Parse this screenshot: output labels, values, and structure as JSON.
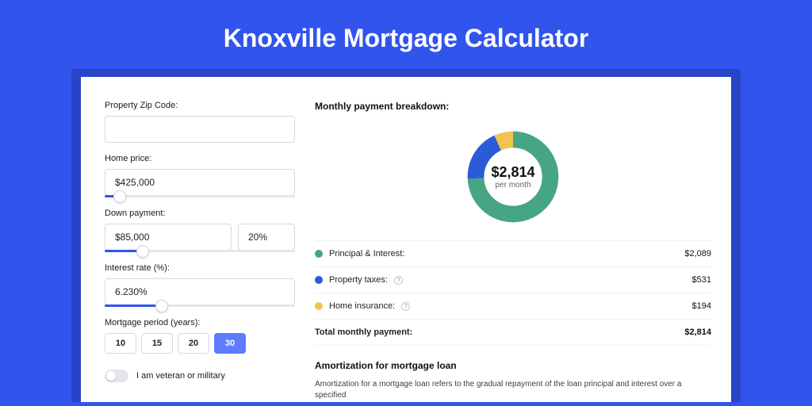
{
  "title": "Knoxville Mortgage Calculator",
  "form": {
    "zip": {
      "label": "Property Zip Code:",
      "value": ""
    },
    "homePrice": {
      "label": "Home price:",
      "value": "$425,000",
      "sliderPct": 8
    },
    "downPayment": {
      "label": "Down payment:",
      "value": "$85,000",
      "pct": "20%",
      "sliderPct": 20
    },
    "interestRate": {
      "label": "Interest rate (%):",
      "value": "6.230%",
      "sliderPct": 30
    },
    "period": {
      "label": "Mortgage period (years):",
      "options": [
        "10",
        "15",
        "20",
        "30"
      ],
      "active": "30"
    },
    "veteran": {
      "label": "I am veteran or military",
      "on": false
    }
  },
  "breakdown": {
    "title": "Monthly payment breakdown:",
    "totalAmount": "$2,814",
    "totalSub": "per month",
    "items": [
      {
        "label": "Principal & Interest:",
        "value": "$2,089",
        "color": "#46a584",
        "info": false
      },
      {
        "label": "Property taxes:",
        "value": "$531",
        "color": "#2b5bd7",
        "info": true
      },
      {
        "label": "Home insurance:",
        "value": "$194",
        "color": "#f3c352",
        "info": true
      }
    ],
    "totalRow": {
      "label": "Total monthly payment:",
      "value": "$2,814"
    }
  },
  "chart_data": {
    "type": "pie",
    "title": "Monthly payment breakdown",
    "series": [
      {
        "name": "Principal & Interest",
        "value": 2089,
        "color": "#46a584"
      },
      {
        "name": "Property taxes",
        "value": 531,
        "color": "#2b5bd7"
      },
      {
        "name": "Home insurance",
        "value": 194,
        "color": "#f3c352"
      }
    ],
    "total": 2814,
    "center_label": "$2,814 per month"
  },
  "amortization": {
    "title": "Amortization for mortgage loan",
    "text": "Amortization for a mortgage loan refers to the gradual repayment of the loan principal and interest over a specified"
  }
}
